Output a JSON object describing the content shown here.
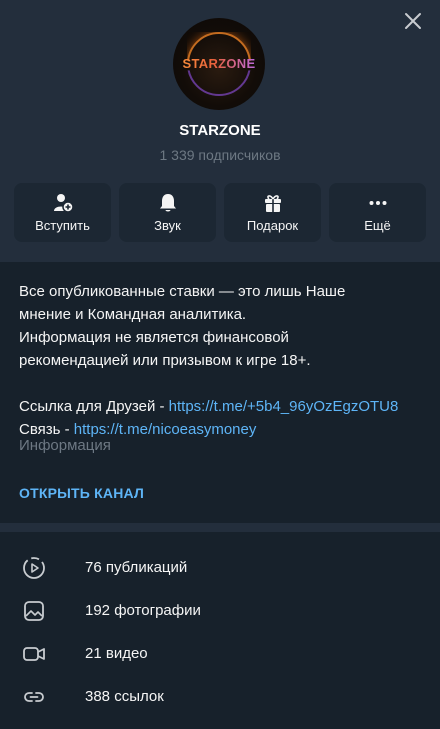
{
  "header": {
    "avatar_logo_text": "STARZONE",
    "title": "STARZONE",
    "subscribers": "1 339 подписчиков",
    "close_icon": "close-icon"
  },
  "actions": [
    {
      "label": "Вступить",
      "icon": "add-user-icon"
    },
    {
      "label": "Звук",
      "icon": "bell-icon"
    },
    {
      "label": "Подарок",
      "icon": "gift-icon"
    },
    {
      "label": "Ещё",
      "icon": "more-icon"
    }
  ],
  "about": {
    "lines": [
      "Все опубликованные ставки — это лишь Наше",
      "мнение и Командная аналитика.",
      "Информация не является финансовой",
      "рекомендацией или призывом к игре 18+."
    ],
    "friends_prefix": "Ссылка для Друзей - ",
    "friends_link": "https://t.me/+5b4_96yOzEgzOTU8",
    "contact_prefix": "Связь - ",
    "contact_link": "https://t.me/nicoeasymoney",
    "caption": "Информация",
    "open_channel": "ОТКРЫТЬ КАНАЛ"
  },
  "stats": [
    {
      "label": "76 публикаций",
      "icon": "posts-icon"
    },
    {
      "label": "192 фотографии",
      "icon": "photo-icon"
    },
    {
      "label": "21 видео",
      "icon": "video-icon"
    },
    {
      "label": "388 ссылок",
      "icon": "link-icon"
    }
  ],
  "colors": {
    "background": "#17212b",
    "header_bg": "#232e3c",
    "button_bg": "#1c2733",
    "accent": "#5eb5f7",
    "muted": "#6d7883"
  }
}
